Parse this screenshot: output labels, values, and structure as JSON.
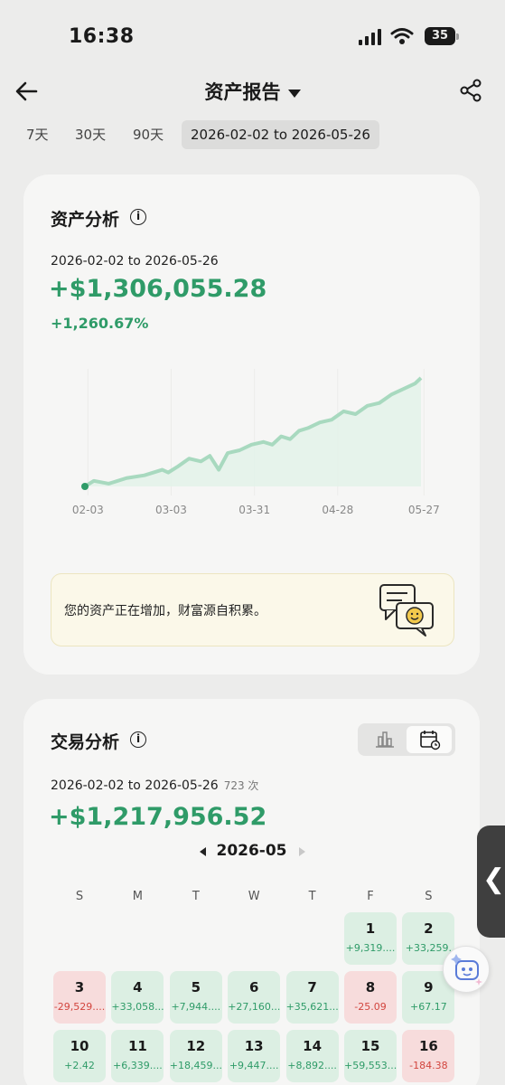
{
  "status_bar": {
    "time": "16:38",
    "battery": "35",
    "icons": [
      "signal-icon",
      "wifi-icon",
      "battery-icon"
    ]
  },
  "header": {
    "title": "资产报告",
    "icons": [
      "back-arrow-icon",
      "dropdown-caret-icon",
      "share-icon"
    ]
  },
  "range_tabs": [
    {
      "label": "7天"
    },
    {
      "label": "30天"
    },
    {
      "label": "90天"
    },
    {
      "label": "2026-02-02 to 2026-05-26",
      "selected": true
    }
  ],
  "asset_analysis": {
    "title": "资产分析",
    "date_range": "2026-02-02 to 2026-05-26",
    "total_gain": "+$1,306,055.28",
    "gain_percent": "+1,260.67%",
    "notice": "您的资产正在增加，财富源自积累。",
    "colors": {
      "positive": "#2f9b68",
      "line": "#a8d9bf",
      "area": "#e2f2e9"
    },
    "chart_data": {
      "type": "area",
      "x_tick_labels": [
        "02-03",
        "03-03",
        "03-31",
        "04-28",
        "05-27"
      ],
      "points": [
        {
          "x": "02-02",
          "y": 0
        },
        {
          "x": "02-05",
          "y": 2
        },
        {
          "x": "02-10",
          "y": 1
        },
        {
          "x": "02-16",
          "y": 3
        },
        {
          "x": "02-22",
          "y": 4
        },
        {
          "x": "02-28",
          "y": 6
        },
        {
          "x": "03-02",
          "y": 5
        },
        {
          "x": "03-05",
          "y": 7
        },
        {
          "x": "03-09",
          "y": 10
        },
        {
          "x": "03-13",
          "y": 9
        },
        {
          "x": "03-16",
          "y": 11
        },
        {
          "x": "03-19",
          "y": 6
        },
        {
          "x": "03-22",
          "y": 12
        },
        {
          "x": "03-26",
          "y": 13
        },
        {
          "x": "03-30",
          "y": 15
        },
        {
          "x": "04-03",
          "y": 16
        },
        {
          "x": "04-06",
          "y": 15
        },
        {
          "x": "04-09",
          "y": 18
        },
        {
          "x": "04-12",
          "y": 17
        },
        {
          "x": "04-15",
          "y": 20
        },
        {
          "x": "04-18",
          "y": 21
        },
        {
          "x": "04-22",
          "y": 23
        },
        {
          "x": "04-26",
          "y": 24
        },
        {
          "x": "04-30",
          "y": 27
        },
        {
          "x": "05-04",
          "y": 26
        },
        {
          "x": "05-08",
          "y": 29
        },
        {
          "x": "05-12",
          "y": 30
        },
        {
          "x": "05-16",
          "y": 33
        },
        {
          "x": "05-20",
          "y": 35
        },
        {
          "x": "05-24",
          "y": 37
        },
        {
          "x": "05-26",
          "y": 39
        }
      ]
    }
  },
  "trade_analysis": {
    "title": "交易分析",
    "date_range": "2026-02-02 to 2026-05-26",
    "count": "723 次",
    "total": "+$1,217,956.52",
    "view_icons": [
      "bar-chart-icon",
      "calendar-icon"
    ],
    "month": "2026-05",
    "weekdays": [
      "S",
      "M",
      "T",
      "W",
      "T",
      "F",
      "S"
    ],
    "days": [
      {
        "day": "1",
        "value": "+9,319....",
        "sign": "pos",
        "col": 5,
        "row": 0
      },
      {
        "day": "2",
        "value": "+33,259.",
        "sign": "pos",
        "col": 6,
        "row": 0
      },
      {
        "day": "3",
        "value": "-29,529....",
        "sign": "neg",
        "col": 0,
        "row": 1
      },
      {
        "day": "4",
        "value": "+33,058....",
        "sign": "pos",
        "col": 1,
        "row": 1
      },
      {
        "day": "5",
        "value": "+7,944....",
        "sign": "pos",
        "col": 2,
        "row": 1
      },
      {
        "day": "6",
        "value": "+27,160....",
        "sign": "pos",
        "col": 3,
        "row": 1
      },
      {
        "day": "7",
        "value": "+35,621....",
        "sign": "pos",
        "col": 4,
        "row": 1
      },
      {
        "day": "8",
        "value": "-25.09",
        "sign": "neg",
        "col": 5,
        "row": 1
      },
      {
        "day": "9",
        "value": "+67.17",
        "sign": "pos",
        "col": 6,
        "row": 1
      },
      {
        "day": "10",
        "value": "+2.42",
        "sign": "pos",
        "col": 0,
        "row": 2
      },
      {
        "day": "11",
        "value": "+6,339....",
        "sign": "pos",
        "col": 1,
        "row": 2
      },
      {
        "day": "12",
        "value": "+18,459....",
        "sign": "pos",
        "col": 2,
        "row": 2
      },
      {
        "day": "13",
        "value": "+9,447....",
        "sign": "pos",
        "col": 3,
        "row": 2
      },
      {
        "day": "14",
        "value": "+8,892....",
        "sign": "pos",
        "col": 4,
        "row": 2
      },
      {
        "day": "15",
        "value": "+59,553....",
        "sign": "pos",
        "col": 5,
        "row": 2
      },
      {
        "day": "16",
        "value": "-184.38",
        "sign": "neg",
        "col": 6,
        "row": 2
      }
    ]
  },
  "floating": {
    "side_handle_icon": "chevron-left-icon",
    "assistant_icon": "robot-assistant-icon"
  }
}
